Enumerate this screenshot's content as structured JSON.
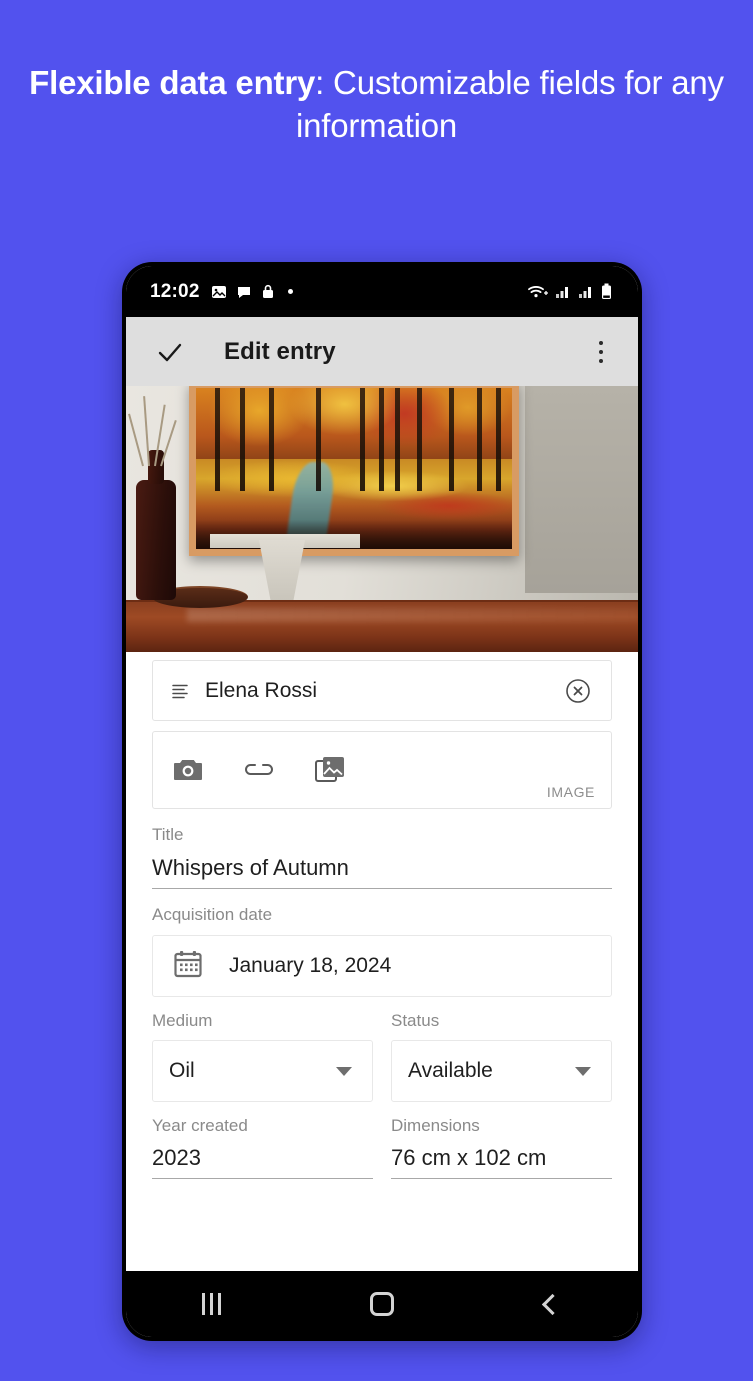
{
  "promo": {
    "headline_bold": "Flexible data entry",
    "headline_rest": ": Customizable fields for any information",
    "background_color": "#5252ee"
  },
  "status_bar": {
    "time": "12:02",
    "left_icons": [
      "image-icon",
      "chat-bubble-icon",
      "lock-icon",
      "dot-icon"
    ],
    "right_icons": [
      "wifi-icon",
      "signal-icon",
      "signal-icon",
      "battery-icon"
    ]
  },
  "app_bar": {
    "confirm_label": "check-icon",
    "title": "Edit entry",
    "overflow_label": "more-vertical-icon"
  },
  "hero": {
    "alt": "Framed autumn forest painting above a wooden table"
  },
  "name_field": {
    "drag_icon": "drag-handle-icon",
    "value": "Elena Rossi",
    "clear_icon": "clear-circle-icon"
  },
  "image_picker": {
    "camera_icon": "camera-icon",
    "link_icon": "link-icon",
    "gallery_icon": "gallery-icon",
    "tag": "IMAGE"
  },
  "fields": {
    "title": {
      "label": "Title",
      "value": "Whispers of Autumn"
    },
    "acquisition_date": {
      "label": "Acquisition date",
      "value": "January 18, 2024",
      "icon": "calendar-icon"
    },
    "medium": {
      "label": "Medium",
      "value": "Oil"
    },
    "status": {
      "label": "Status",
      "value": "Available"
    },
    "year_created": {
      "label": "Year created",
      "value": "2023"
    },
    "dimensions": {
      "label": "Dimensions",
      "value": "76 cm x 102 cm"
    }
  },
  "nav_bar": {
    "recents": "recents-icon",
    "home": "home-icon",
    "back": "back-icon"
  }
}
